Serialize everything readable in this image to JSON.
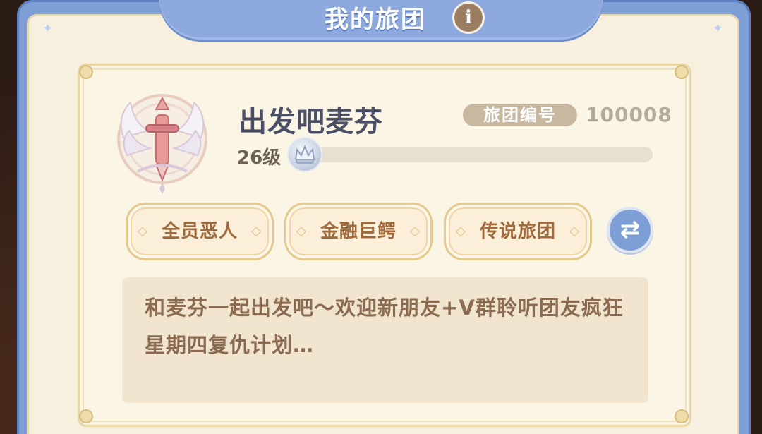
{
  "header": {
    "title": "我的旅团",
    "info_icon": "info-icon",
    "info_glyph": "i"
  },
  "guild": {
    "name": "出发吧麦芬",
    "id_label": "旅团编号",
    "id_value": "100008",
    "level_text": "26级",
    "level_progress": 0.06,
    "emblem_icon": "winged-sword-emblem-icon",
    "rank_icon": "crown-icon"
  },
  "tags": [
    {
      "label": "全员恶人"
    },
    {
      "label": "金融巨鳄"
    },
    {
      "label": "传说旅团"
    }
  ],
  "swap_button": {
    "icon": "swap-arrows-icon",
    "glyph": "⇄"
  },
  "description": {
    "text": "和麦芬一起出发吧～欢迎新朋友+V群聆听团友疯狂星期四复仇计划…"
  },
  "colors": {
    "frame_blue": "#7e9ed6",
    "parchment": "#fbf5e6",
    "tag_text": "#a06a3c",
    "name_text": "#4a4f66"
  }
}
